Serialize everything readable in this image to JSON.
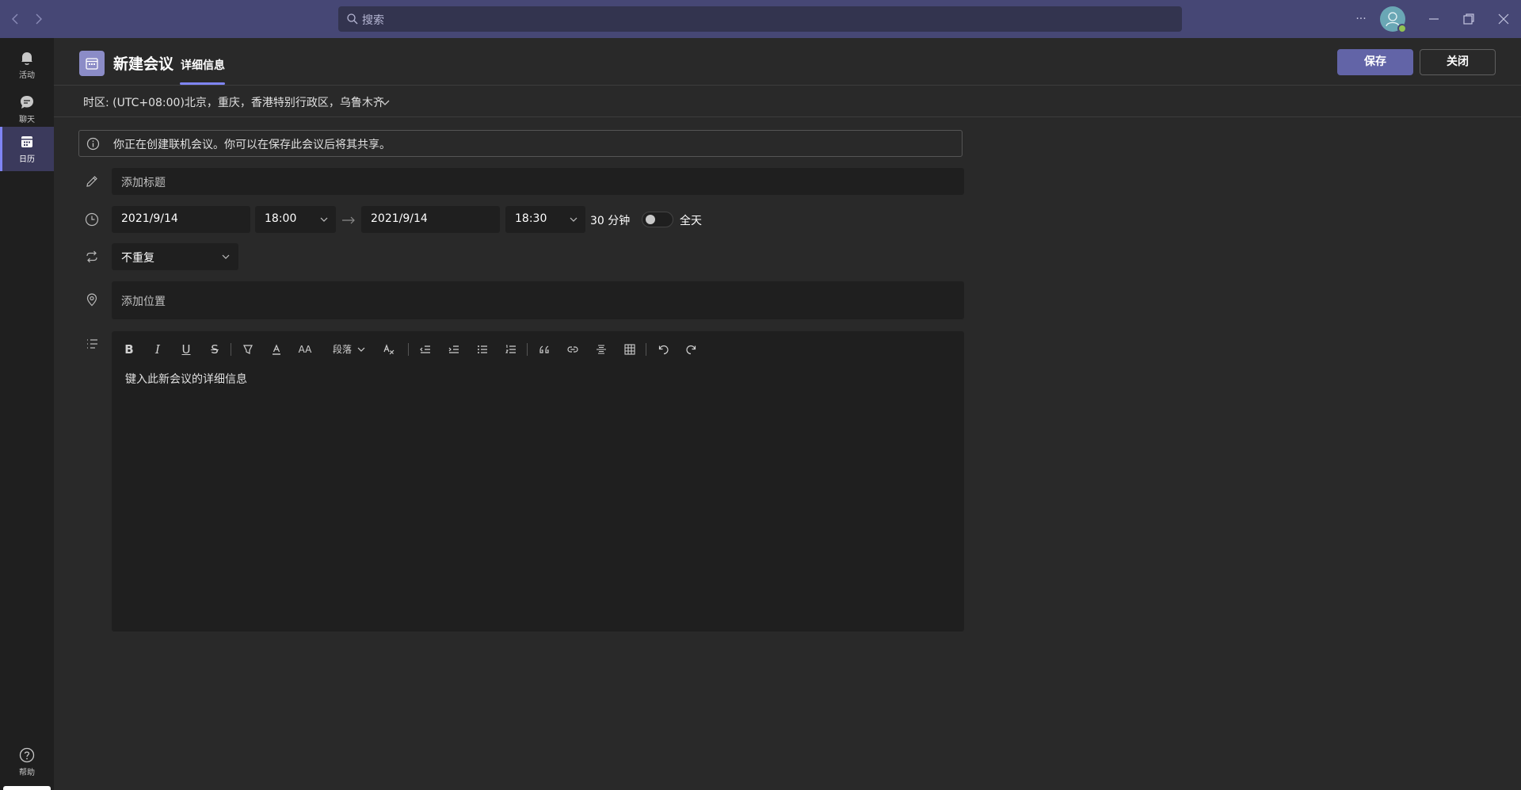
{
  "titlebar": {
    "search_placeholder": "搜索",
    "more_label": "···"
  },
  "rail": {
    "items": [
      {
        "label": "活动",
        "icon": "bell-icon"
      },
      {
        "label": "聊天",
        "icon": "chat-icon"
      },
      {
        "label": "日历",
        "icon": "calendar-icon",
        "active": true
      }
    ],
    "help_label": "帮助"
  },
  "header": {
    "title": "新建会议",
    "tab": "详细信息",
    "save_label": "保存",
    "close_label": "关闭"
  },
  "timezone": {
    "label": "时区: (UTC+08:00)北京，重庆，香港特别行政区，乌鲁木齐"
  },
  "info_banner": {
    "text": "你正在创建联机会议。你可以在保存此会议后将其共享。"
  },
  "form": {
    "title_placeholder": "添加标题",
    "start_date": "2021/9/14",
    "start_time": "18:00",
    "end_date": "2021/9/14",
    "end_time": "18:30",
    "duration": "30 分钟",
    "all_day_label": "全天",
    "all_day_on": false,
    "repeat": "不重复",
    "location_placeholder": "添加位置"
  },
  "editor": {
    "paragraph_label": "段落",
    "placeholder": "键入此新会议的详细信息"
  },
  "colors": {
    "titlebar": "#464775",
    "accent": "#6264a7",
    "rail": "#1f1f1f",
    "background": "#292929",
    "field": "#1f1f1f"
  }
}
